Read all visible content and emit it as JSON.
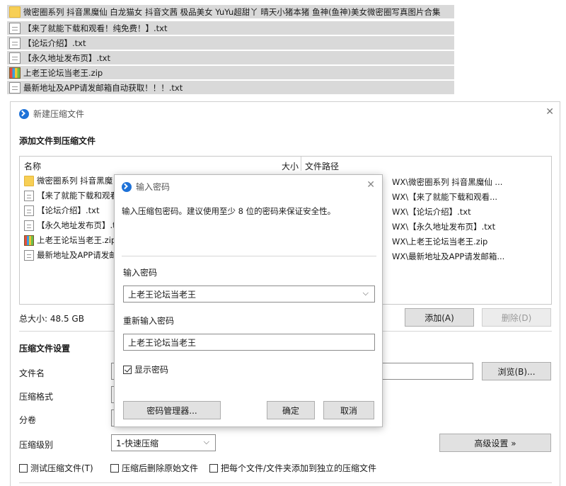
{
  "files": [
    {
      "name": "微密圈系列 抖音黑魔仙 白龙猫女 抖音文茜 极品美女 YuYu超甜丫 晴天小猪本猪 鱼神(鱼神)美女微密圈写真图片合集",
      "icon": "folder-icon"
    },
    {
      "name": "【来了就能下载和观看！纯免费！】.txt",
      "icon": "txt-file-icon"
    },
    {
      "name": "【论坛介绍】.txt",
      "icon": "txt-file-icon"
    },
    {
      "name": "【永久地址发布页】.txt",
      "icon": "txt-file-icon"
    },
    {
      "name": "上老王论坛当老王.zip",
      "icon": "zip-archive-icon"
    },
    {
      "name": "最新地址及APP请发邮箱自动获取！！！.txt",
      "icon": "txt-file-icon"
    }
  ],
  "main_dialog": {
    "title": "新建压缩文件",
    "close": "✕",
    "section_add": "添加文件到压缩文件",
    "columns": {
      "name": "名称",
      "size": "大小",
      "path": "文件路径"
    },
    "list": [
      {
        "name": "微密圈系列 抖音黑魔",
        "path": "WX\\微密圈系列 抖音黑魔仙 ..."
      },
      {
        "name": "【来了就能下载和观看",
        "path": "WX\\【来了就能下载和观看..."
      },
      {
        "name": "【论坛介绍】.txt",
        "path": "WX\\【论坛介绍】.txt"
      },
      {
        "name": "【永久地址发布页】.t",
        "path": "WX\\【永久地址发布页】.txt"
      },
      {
        "name": "上老王论坛当老王.zip",
        "path": "WX\\上老王论坛当老王.zip"
      },
      {
        "name": "最新地址及APP请发邮",
        "path": "WX\\最新地址及APP请发邮箱..."
      }
    ],
    "total_size": "总大小: 48.5 GB",
    "add_button": "添加(A)",
    "delete_button": "删除(D)",
    "section_settings": "压缩文件设置",
    "filename_label": "文件名",
    "browse_button": "浏览(B)...",
    "format_label": "压缩格式",
    "split_label": "分卷",
    "level_label": "压缩级别",
    "level_value": "1-快速压缩",
    "advanced_button": "高级设置 »",
    "check_test": "测试压缩文件(T)",
    "check_delete": "压缩后删除原始文件",
    "check_separate": "把每个文件/文件夹添加到独立的压缩文件"
  },
  "password_dialog": {
    "title": "输入密码",
    "close": "✕",
    "instruction": "输入压缩包密码。建议使用至少 8 位的密码来保证安全性。",
    "enter_label": "输入密码",
    "password_value": "上老王论坛当老王",
    "reenter_label": "重新输入密码",
    "reenter_value": "上老王论坛当老王",
    "show_password": "显示密码",
    "show_password_checked": true,
    "manager_button": "密码管理器...",
    "ok_button": "确定",
    "cancel_button": "取消"
  }
}
